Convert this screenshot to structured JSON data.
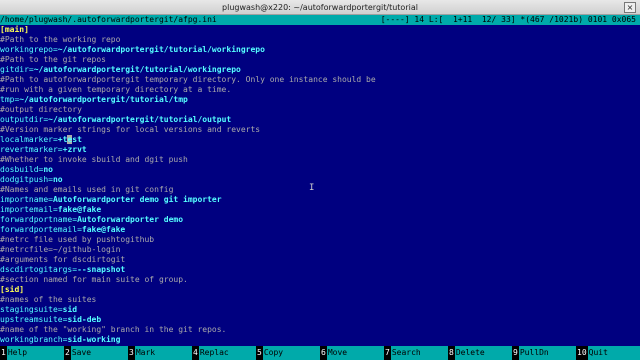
{
  "window": {
    "title": "plugwash@x220: ~/autoforwardportergit/tutorial",
    "close_glyph": "×"
  },
  "status": {
    "path": "/home/plugwash/.autoforwardportergit/afpg.ini",
    "info": "[----] 14 L:[  1+11  12/ 33] *(467 /1021b) 0101 0x065"
  },
  "lines": [
    [
      [
        "sec",
        "[main]"
      ]
    ],
    [
      [
        "txt",
        "#Path to the working repo"
      ]
    ],
    [
      [
        "key",
        "workingrepo="
      ],
      [
        "val",
        "~/autoforwardportergit/tutorial/workingrepo"
      ]
    ],
    [
      [
        "txt",
        "#Path to the git repos"
      ]
    ],
    [
      [
        "key",
        "gitdir="
      ],
      [
        "val",
        "~/autoforwardportergit/tutorial/workingrepo"
      ]
    ],
    [
      [
        "txt",
        "#Path to autoforwardportergit temporary directory. Only one instance should be"
      ]
    ],
    [
      [
        "txt",
        "#run with a given temporary directory at a time."
      ]
    ],
    [
      [
        "key",
        "tmp="
      ],
      [
        "val",
        "~/autoforwardportergit/tutorial/tmp"
      ]
    ],
    [
      [
        "txt",
        "#output directory"
      ]
    ],
    [
      [
        "key",
        "outputdir="
      ],
      [
        "val",
        "~/autoforwardportergit/tutorial/output"
      ]
    ],
    [
      [
        "txt",
        "#Version marker strings for local versions and reverts"
      ]
    ],
    [
      [
        "key",
        "localmarker="
      ],
      [
        "val",
        "+t"
      ],
      [
        "cur",
        "e"
      ],
      [
        "val",
        "st"
      ]
    ],
    [
      [
        "key",
        "revertmarker="
      ],
      [
        "val",
        "+zrvt"
      ]
    ],
    [
      [
        "txt",
        "#Whether to invoke sbuild and dgit push"
      ]
    ],
    [
      [
        "key",
        "dosbuild="
      ],
      [
        "val",
        "no"
      ]
    ],
    [
      [
        "key",
        "dodgitpush="
      ],
      [
        "val",
        "no"
      ]
    ],
    [
      [
        "txt",
        "#Names and emails used in git config"
      ]
    ],
    [
      [
        "key",
        "importname="
      ],
      [
        "val",
        "Autoforwardporter demo git importer"
      ]
    ],
    [
      [
        "key",
        "importemail="
      ],
      [
        "val",
        "fake@fake"
      ]
    ],
    [
      [
        "key",
        "forwardportname="
      ],
      [
        "val",
        "Autoforwardporter demo"
      ]
    ],
    [
      [
        "key",
        "forwardportemail="
      ],
      [
        "val",
        "fake@fake"
      ]
    ],
    [
      [
        "txt",
        "#netrc file used by pushtogithub"
      ]
    ],
    [
      [
        "txt",
        "#netrcfile=~/github-login"
      ]
    ],
    [
      [
        "txt",
        "#arguments for dscdirtogit"
      ]
    ],
    [
      [
        "key",
        "dscdirtogitargs="
      ],
      [
        "val",
        "--snapshot"
      ]
    ],
    [
      [
        "txt",
        "#section named for main suite of group."
      ]
    ],
    [
      [
        "sec",
        "[sid]"
      ]
    ],
    [
      [
        "txt",
        "#names of the suites"
      ]
    ],
    [
      [
        "key",
        "stagingsuite="
      ],
      [
        "val",
        "sid"
      ]
    ],
    [
      [
        "key",
        "upstreamsuite="
      ],
      [
        "val",
        "sid-deb"
      ]
    ],
    [
      [
        "txt",
        "#name of the \"working\" branch in the git repos."
      ]
    ],
    [
      [
        "key",
        "workingbranch="
      ],
      [
        "val",
        "sid-working"
      ]
    ]
  ],
  "fkeys": [
    {
      "num": "1",
      "label": "Help"
    },
    {
      "num": "2",
      "label": "Save"
    },
    {
      "num": "3",
      "label": "Mark"
    },
    {
      "num": "4",
      "label": "Replac"
    },
    {
      "num": "5",
      "label": "Copy"
    },
    {
      "num": "6",
      "label": "Move"
    },
    {
      "num": "7",
      "label": "Search"
    },
    {
      "num": "8",
      "label": "Delete"
    },
    {
      "num": "9",
      "label": "PullDn"
    },
    {
      "num": "10",
      "label": "Quit"
    }
  ]
}
